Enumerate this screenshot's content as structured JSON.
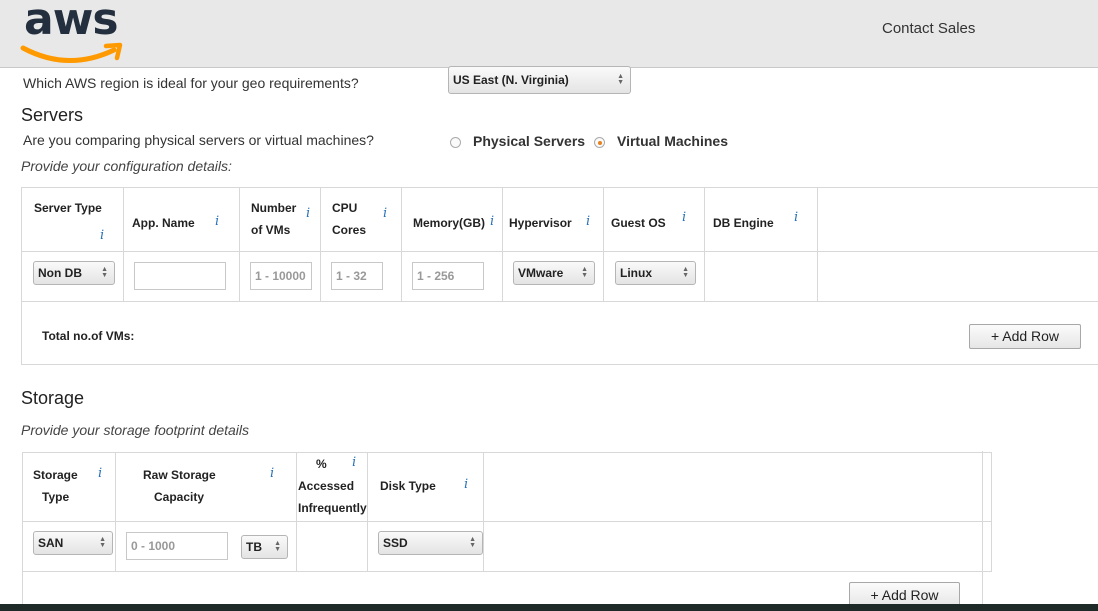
{
  "header": {
    "logo_text": "aws",
    "contact_label": "Contact Sales"
  },
  "region": {
    "question": "Which AWS region is ideal for your geo requirements?",
    "selected": "US East (N. Virginia)"
  },
  "servers": {
    "title": "Servers",
    "compare_question": "Are you comparing physical servers or virtual machines?",
    "options": [
      {
        "label": "Physical Servers",
        "checked": false
      },
      {
        "label": "Virtual Machines",
        "checked": true
      }
    ],
    "config_prompt": "Provide your configuration details:",
    "columns": [
      "Server Type",
      "App. Name",
      "Number of VMs",
      "CPU Cores",
      "Memory(GB)",
      "Hypervisor",
      "Guest OS",
      "DB Engine"
    ],
    "column_lines": {
      "number_of_vms": [
        "Number",
        "of VMs"
      ],
      "cpu_cores": [
        "CPU",
        "Cores"
      ]
    },
    "row": {
      "server_type": "Non DB",
      "app_name": "",
      "vms_placeholder": "1 - 10000",
      "cpu_placeholder": "1 - 32",
      "memory_placeholder": "1 - 256",
      "hypervisor": "VMware",
      "guest_os": "Linux"
    },
    "total_label": "Total no.of VMs:",
    "add_row_label": "+ Add Row"
  },
  "storage": {
    "title": "Storage",
    "prompt": "Provide your storage footprint details",
    "column_lines": {
      "storage_type": [
        "Storage",
        "Type"
      ],
      "raw_capacity": [
        "Raw Storage",
        "Capacity"
      ],
      "accessed": [
        "%",
        "Accessed",
        "Infrequently"
      ],
      "disk_type": [
        "Disk Type"
      ]
    },
    "row": {
      "storage_type": "SAN",
      "capacity_placeholder": "0 - 1000",
      "unit": "TB",
      "disk_type": "SSD"
    },
    "add_row_label": "+ Add Row"
  },
  "icons": {
    "info": "i",
    "select_arrows": "▲▼"
  },
  "colors": {
    "accent_orange": "#ff9900",
    "info_blue": "#2a73b7",
    "radio_checked": "#e8811f",
    "header_bg": "#e8e8e8"
  }
}
